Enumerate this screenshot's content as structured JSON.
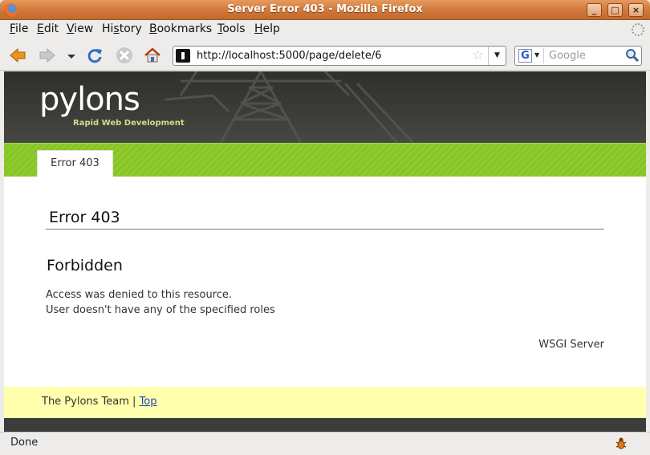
{
  "window": {
    "title": "Server Error 403 - Mozilla Firefox",
    "minimize": "_",
    "maximize": "□",
    "close": "×"
  },
  "menu": [
    {
      "key": "F",
      "rest": "ile"
    },
    {
      "key": "E",
      "rest": "dit"
    },
    {
      "key": "V",
      "rest": "iew"
    },
    {
      "pre": "Hi",
      "key": "s",
      "rest": "tory"
    },
    {
      "key": "B",
      "rest": "ookmarks"
    },
    {
      "key": "T",
      "rest": "ools"
    },
    {
      "key": "H",
      "rest": "elp"
    }
  ],
  "address": {
    "url": "http://localhost:5000/page/delete/6"
  },
  "search": {
    "engine_letter": "G",
    "placeholder": "Google"
  },
  "page": {
    "logo": "pylons",
    "tagline": "Rapid Web Development",
    "tab_label": "Error 403",
    "heading": "Error 403",
    "subheading": "Forbidden",
    "message_line1": "Access was denied to this resource.",
    "message_line2": "User doesn't have any of the specified roles",
    "server": "WSGI Server",
    "footer_team": "The Pylons Team |",
    "footer_link": "Top"
  },
  "status": {
    "text": "Done"
  },
  "colors": {
    "titlebar": "#d27a3c",
    "green_bar": "#8fcb2f",
    "footer_bg": "#ffffad",
    "link": "#2346b8"
  }
}
